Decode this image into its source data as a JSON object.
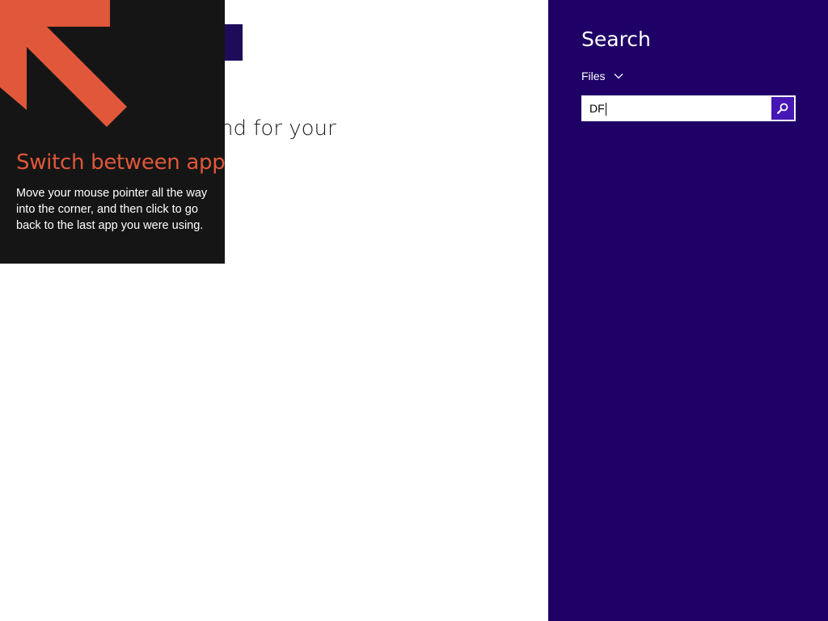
{
  "background": {
    "partial_text": "nd for your"
  },
  "tip": {
    "title": "Switch between apps",
    "body": "Move your mouse pointer all the way into the corner, and then click to go back to the last app you were using.",
    "accent_color": "#e0573a",
    "arrow_icon": "arrow-up-left-icon"
  },
  "search_charm": {
    "title": "Search",
    "scope_label": "Files",
    "query_value": "DF",
    "background_color": "#1e0066",
    "search_button_icon": "search-icon",
    "search_button_color": "#4617b4"
  }
}
